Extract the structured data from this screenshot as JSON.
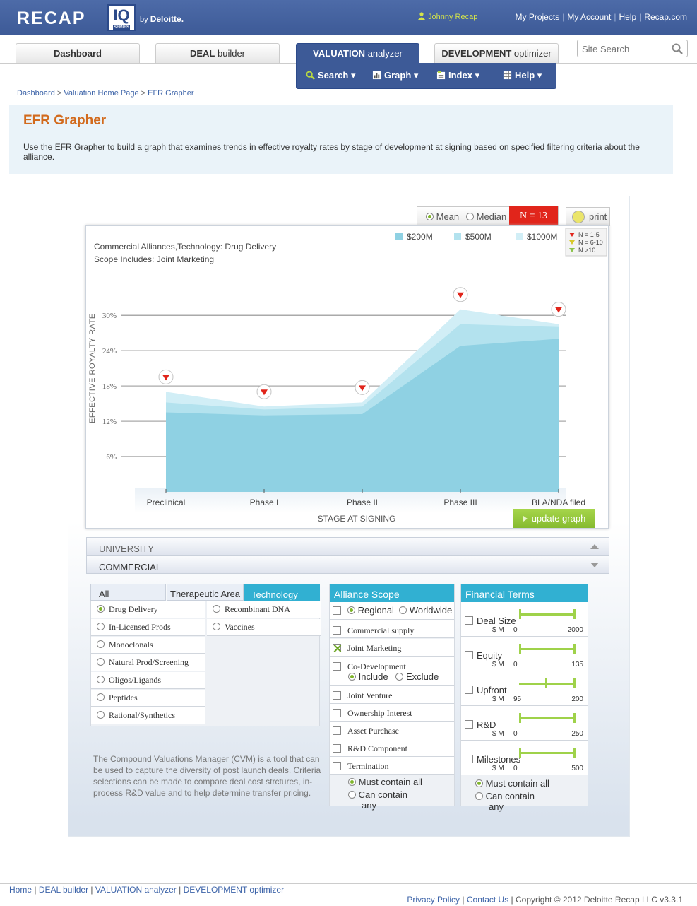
{
  "header": {
    "logo_text": "RECAP",
    "logo_iq": "IQ",
    "logo_series": "SERIES",
    "by": "by",
    "brand": "Deloitte.",
    "user_name": "Johnny Recap",
    "links": [
      "My Projects",
      "My Account",
      "Help",
      "Recap.com"
    ]
  },
  "tabs": {
    "dashboard": "Dashboard",
    "deal_a": "DEAL",
    "deal_b": " builder",
    "valuation_a": "VALUATION",
    "valuation_b": " analyzer",
    "dev_a": "DEVELOPMENT",
    "dev_b": " optimizer"
  },
  "subnav": {
    "search": "Search ▾",
    "graph": "Graph ▾",
    "index": "Index ▾",
    "help": "Help ▾"
  },
  "search": {
    "placeholder": "Site Search"
  },
  "breadcrumb": [
    "Dashboard",
    "Valuation Home Page",
    "EFR Grapher"
  ],
  "intro": {
    "title": "EFR Grapher",
    "text": "Use the EFR Grapher to build a graph that examines trends in effective royalty rates by stage of development at signing based on specified filtering criteria about the alliance."
  },
  "controls": {
    "mean": "Mean",
    "median": "Median",
    "n_badge": "N = 13",
    "print": "print",
    "update": "update graph"
  },
  "colors": {
    "series_200": "#8fd1e3",
    "series_500": "#b3e2ee",
    "series_1000": "#d1eef6",
    "accent": "#31b0d2",
    "badge": "#e1251b"
  },
  "chart_data": {
    "type": "area",
    "subtitle_line1": "Commercial Alliances,Technology: Drug Delivery",
    "subtitle_line2": "Scope Includes: Joint Marketing",
    "xlabel": "STAGE AT SIGNING",
    "ylabel": "EFFECTIVE ROYALTY RATE",
    "categories": [
      "Preclinical",
      "Phase I",
      "Phase II",
      "Phase III",
      "BLA/NDA filed"
    ],
    "yticks": [
      "6%",
      "12%",
      "18%",
      "24%",
      "30%"
    ],
    "ylim": [
      0,
      30
    ],
    "series": [
      {
        "name": "$1000M",
        "values": [
          17.0,
          14.5,
          15.2,
          31.0,
          28.5
        ]
      },
      {
        "name": "$500M",
        "values": [
          15.2,
          14.0,
          14.5,
          28.5,
          28.0
        ]
      },
      {
        "name": "$200M",
        "values": [
          13.5,
          13.0,
          13.2,
          24.8,
          26.0
        ]
      }
    ],
    "indicator_legend": [
      "N = 1-5",
      "N = 6-10",
      "N >10"
    ]
  },
  "accordion": {
    "university": "UNIVERSITY",
    "commercial": "COMMERCIAL"
  },
  "filters": {
    "tabs": [
      "All",
      "Therapeutic Area",
      "Technology"
    ],
    "tech_left": [
      "Drug Delivery",
      "In-Licensed Prods",
      "Monoclonals",
      "Natural Prod/Screening",
      "Oligos/Ligands",
      "Peptides",
      "Rational/Synthetics"
    ],
    "tech_right": [
      "Recombinant DNA",
      "Vaccines"
    ],
    "cvm_text": "The Compound Valuations Manager (CVM) is a tool that can be used to capture the diversity of post launch deals. Criteria selections can be made to compare deal cost strctures, in-process R&D value and to help determine transfer pricing."
  },
  "scope": {
    "title": "Alliance Scope",
    "regional": "Regional",
    "worldwide": "Worldwide",
    "items": [
      "Commercial supply",
      "Joint Marketing",
      "Co-Development",
      "Joint Venture",
      "Ownership Interest",
      "Asset Purchase",
      "R&D Component",
      "Termination"
    ],
    "include": "Include",
    "exclude": "Exclude",
    "must": "Must contain all",
    "can": "Can contain",
    "any": "any"
  },
  "finance": {
    "title": "Financial Terms",
    "unit": "$ M",
    "items": [
      {
        "name": "Deal Size",
        "min": "0",
        "max": "2000",
        "lo": 0,
        "hi": 1
      },
      {
        "name": "Equity",
        "min": "0",
        "max": "135",
        "lo": 0,
        "hi": 1
      },
      {
        "name": "Upfront",
        "min": "95",
        "max": "200",
        "lo": 0.48,
        "hi": 1
      },
      {
        "name": "R&D",
        "min": "0",
        "max": "250",
        "lo": 0,
        "hi": 1
      },
      {
        "name": "Milestones",
        "min": "0",
        "max": "500",
        "lo": 0,
        "hi": 1
      }
    ],
    "must": "Must contain all",
    "can": "Can contain",
    "any": "any"
  },
  "footer": {
    "nav": [
      "Home",
      "DEAL builder",
      "VALUATION analyzer",
      "DEVELOPMENT optimizer"
    ],
    "privacy": "Privacy Policy",
    "contact": "Contact Us",
    "copyright": "Copyright © 2012 Deloitte Recap LLC v3.3.1"
  }
}
